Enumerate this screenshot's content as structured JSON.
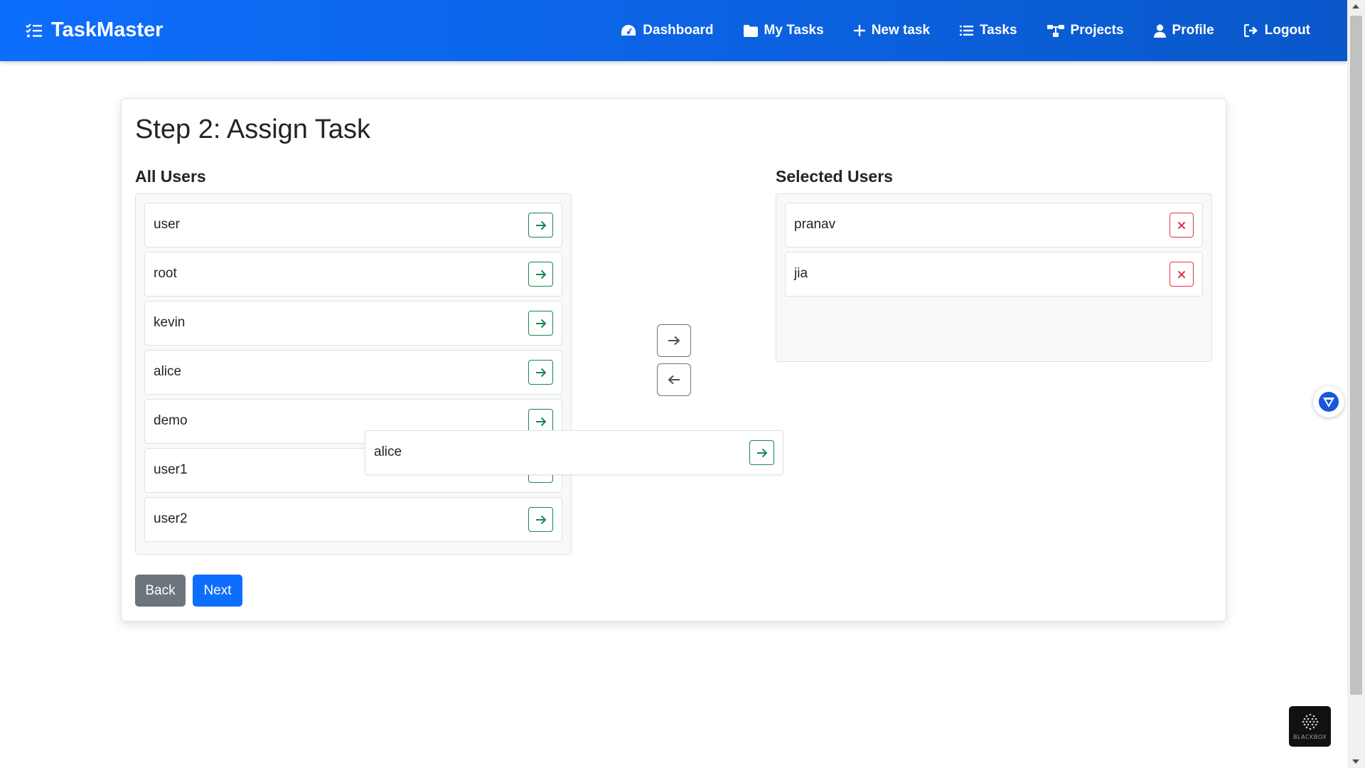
{
  "navbar": {
    "brand": "TaskMaster",
    "items": [
      {
        "label": "Dashboard",
        "icon": "gauge-icon"
      },
      {
        "label": "My Tasks",
        "icon": "folder-icon"
      },
      {
        "label": "New task",
        "icon": "plus-icon"
      },
      {
        "label": "Tasks",
        "icon": "list-icon"
      },
      {
        "label": "Projects",
        "icon": "sitemap-icon"
      },
      {
        "label": "Profile",
        "icon": "user-icon"
      },
      {
        "label": "Logout",
        "icon": "logout-icon"
      }
    ]
  },
  "card": {
    "title": "Step 2: Assign Task",
    "all_users_title": "All Users",
    "selected_users_title": "Selected Users"
  },
  "all_users": [
    "user",
    "root",
    "kevin",
    "alice",
    "demo",
    "user1",
    "user2"
  ],
  "selected_users": [
    "pranav",
    "jia"
  ],
  "drag_ghost": {
    "name": "alice"
  },
  "buttons": {
    "back": "Back",
    "next": "Next"
  },
  "overlay": {
    "blackbox_label": "BLACKBOX"
  },
  "colors": {
    "primary": "#0d6efd",
    "success": "#198754",
    "danger": "#dc3545",
    "secondary": "#6c757d"
  }
}
